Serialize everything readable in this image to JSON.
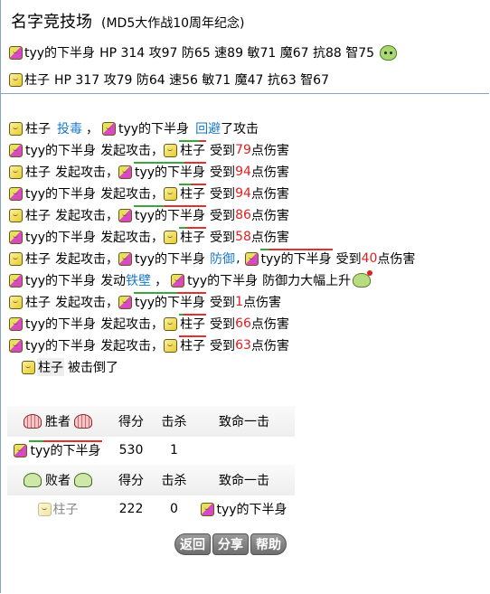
{
  "header": {
    "title": "名字竞技场",
    "subtitle": "(MD5大作战10周年纪念)"
  },
  "players": [
    {
      "name": "tyy的下半身",
      "stats": "HP 314 攻97 防65 速89 敏71 魔67 抗88 智75",
      "icon": "pink"
    },
    {
      "name": "柱子",
      "stats": "HP 317 攻79 防64 速56 敏71 魔47 抗63 智67",
      "icon": "yellow"
    }
  ],
  "log": {
    "l1": {
      "a": "柱子",
      "s1": "投毒",
      "sep": "，",
      "b": "tyy的下半身",
      "s2": "回避",
      "t": "了攻击"
    },
    "l2": {
      "a": "tyy的下半身",
      "v": "发起攻击，",
      "b": "柱子",
      "pre": "受到",
      "d": "79",
      "post": "点伤害"
    },
    "l3": {
      "a": "柱子",
      "v": "发起攻击，",
      "b": "tyy的下半身",
      "pre": "受到",
      "d": "94",
      "post": "点伤害"
    },
    "l4": {
      "a": "tyy的下半身",
      "v": "发起攻击，",
      "b": "柱子",
      "pre": "受到",
      "d": "94",
      "post": "点伤害"
    },
    "l5": {
      "a": "柱子",
      "v": "发起攻击，",
      "b": "tyy的下半身",
      "pre": "受到",
      "d": "86",
      "post": "点伤害"
    },
    "l6": {
      "a": "tyy的下半身",
      "v": "发起攻击，",
      "b": "柱子",
      "pre": "受到",
      "d": "58",
      "post": "点伤害"
    },
    "l7": {
      "a": "柱子",
      "v": "发起攻击，",
      "b": "tyy的下半身",
      "s": "防御",
      "sep": ",",
      "c": "tyy的下半身",
      "pre": "受到",
      "d": "40",
      "post": "点伤害"
    },
    "l8": {
      "a": "tyy的下半身",
      "v": "发动",
      "s": "铁壁",
      "sep": "，",
      "b": "tyy的下半身",
      "t": "防御力大幅上升"
    },
    "l9": {
      "a": "柱子",
      "v": "发起攻击，",
      "b": "tyy的下半身",
      "pre": "受到",
      "d": "1",
      "post": "点伤害"
    },
    "l10": {
      "a": "tyy的下半身",
      "v": "发起攻击，",
      "b": "柱子",
      "pre": "受到",
      "d": "66",
      "post": "点伤害"
    },
    "l11": {
      "a": "tyy的下半身",
      "v": "发起攻击，",
      "b": "柱子",
      "pre": "受到",
      "d": "63",
      "post": "点伤害"
    },
    "l12": {
      "a": "柱子",
      "t": "被击倒了"
    }
  },
  "winners": {
    "header": {
      "label": "胜者",
      "score": "得分",
      "kills": "击杀",
      "fatal": "致命一击"
    },
    "row": {
      "name": "tyy的下半身",
      "score": "530",
      "kills": "1",
      "fatal": ""
    }
  },
  "losers": {
    "header": {
      "label": "败者",
      "score": "得分",
      "kills": "击杀",
      "fatal": "致命一击"
    },
    "row": {
      "name": "柱子",
      "score": "222",
      "kills": "0",
      "fatal": "tyy的下半身"
    }
  },
  "buttons": {
    "back": "返回",
    "share": "分享",
    "help": "帮助"
  },
  "colors": {
    "damage": "#e02020",
    "skill": "#1a7ac8",
    "divider": "#8aa2c8"
  }
}
